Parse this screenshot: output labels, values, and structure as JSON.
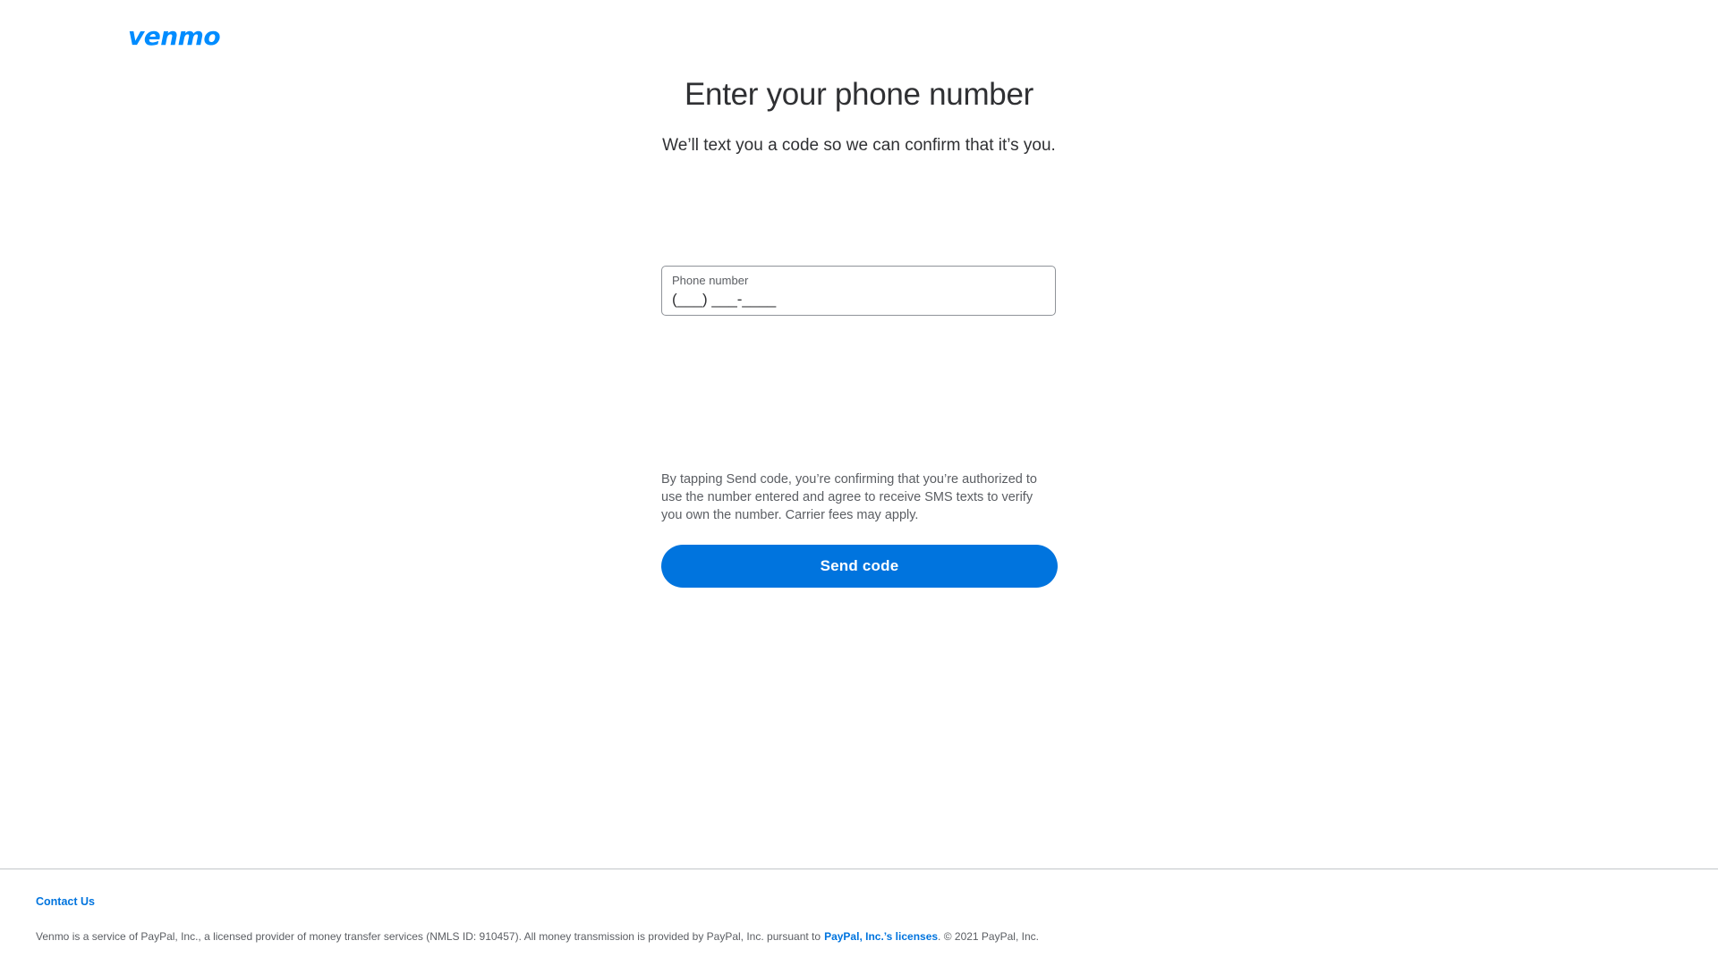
{
  "header": {
    "logo_text": "venmo"
  },
  "main": {
    "title": "Enter your phone number",
    "subtitle": "We’ll text you a code so we can confirm that it’s you.",
    "phone_field": {
      "label": "Phone number",
      "placeholder": "(___) ___-____",
      "value": ""
    },
    "disclaimer": "By tapping Send code, you’re confirming that you’re authorized to use the number entered and agree to receive SMS texts to verify you own the number. Carrier fees may apply.",
    "send_button_label": "Send code"
  },
  "footer": {
    "contact_label": "Contact Us",
    "legal_prefix": "Venmo is a service of PayPal, Inc., a licensed provider of money transfer services (NMLS ID: 910457). All money transmission is provided by PayPal, Inc. pursuant to",
    "legal_link_label": "PayPal, Inc.’s licenses",
    "legal_suffix": ". © 2021 PayPal, Inc."
  },
  "colors": {
    "brand": "#008cff",
    "primary_button": "#0074de",
    "link": "#0074de",
    "text": "#2f3033"
  }
}
